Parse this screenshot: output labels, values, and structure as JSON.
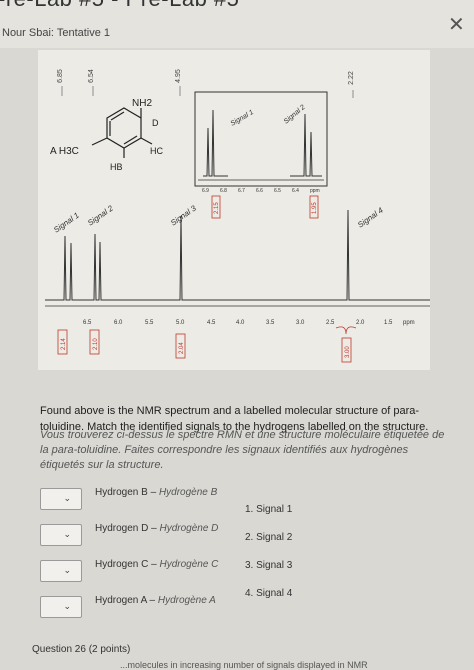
{
  "header": {
    "title": "-re-Lab #5 - Pre-Lab #5",
    "attempt": "Nour Sbai: Tentative 1",
    "close_symbol": "✕"
  },
  "spectrum": {
    "top_peak_labels": [
      "6.85",
      "6.54",
      "4.95",
      "2.22"
    ],
    "structure": {
      "nh2": "NH2",
      "d": "D",
      "h3c": "A H3C",
      "hb": "HB",
      "hc": "HC"
    },
    "signal_labels": [
      "Signal 1",
      "Signal 2",
      "Signal 3",
      "Signal 4"
    ],
    "inset_signal_labels": [
      "Signal 1",
      "Signal 2"
    ],
    "inset_axis": [
      "6.9",
      "6.8",
      "6.7",
      "6.6",
      "6.5",
      "6.4",
      "ppm"
    ],
    "inset_integrals": [
      "2.15",
      "1.95"
    ],
    "main_axis": [
      "6.5",
      "6.0",
      "5.5",
      "5.0",
      "4.5",
      "4.0",
      "3.5",
      "3.0",
      "2.5",
      "2.0",
      "1.5",
      "ppm"
    ],
    "integrals": [
      "2.14",
      "2.10",
      "2.04",
      "3.00"
    ]
  },
  "question": {
    "english": "Found above is the NMR spectrum and a labelled molecular structure of para-toluidine. Match the identified signals to the hydrogens labelled on the structure.",
    "french": "Vous trouverez ci-dessus le spectre RMN et une structure moléculaire étiquetée de la para-toluidine. Faites correspondre les signaux identifiés aux hydrogènes étiquetés sur la structure."
  },
  "matching": {
    "rows": [
      {
        "hydrogen_en": "Hydrogen B",
        "hydrogen_fr": "Hydrogène B",
        "signal": "1.  Signal 1"
      },
      {
        "hydrogen_en": "Hydrogen D",
        "hydrogen_fr": "Hydrogène D",
        "signal": "2.  Signal 2"
      },
      {
        "hydrogen_en": "Hydrogen C",
        "hydrogen_fr": "Hydrogène C",
        "signal": "3.  Signal 3"
      },
      {
        "hydrogen_en": "Hydrogen A",
        "hydrogen_fr": "Hydrogène A",
        "signal": "4.  Signal 4"
      }
    ]
  },
  "footer": {
    "question_label": "Question 26 (2 points)",
    "cut_text": "...molecules in increasing number of signals displayed in NMR"
  },
  "colors": {
    "integral_red": "#c0392b",
    "spectrum_line": "#333333"
  }
}
